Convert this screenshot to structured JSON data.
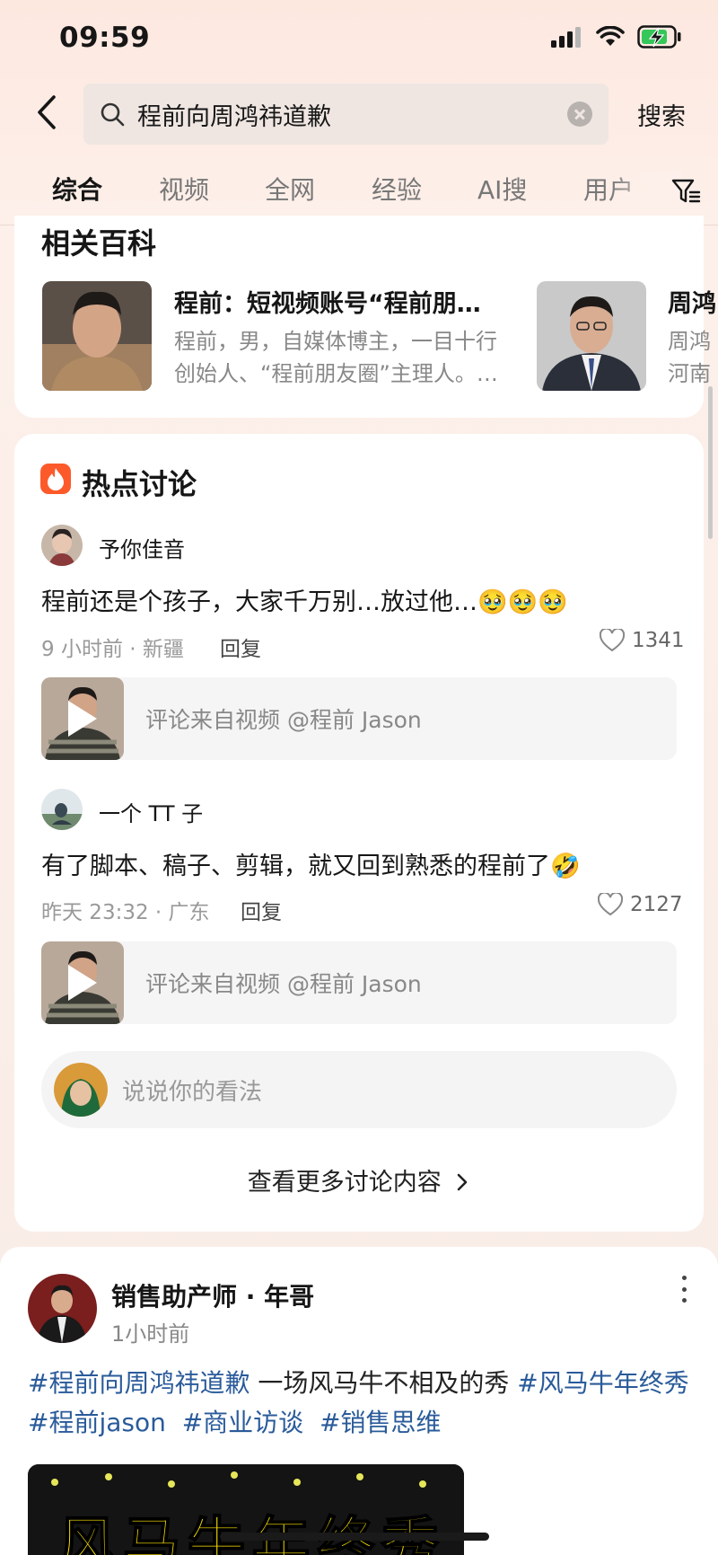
{
  "status_bar": {
    "time": "09:59"
  },
  "search": {
    "query": "程前向周鸿祎道歉",
    "button_label": "搜索"
  },
  "tabs": [
    {
      "label": "综合",
      "active": true
    },
    {
      "label": "视频"
    },
    {
      "label": "全网"
    },
    {
      "label": "经验"
    },
    {
      "label": "AI搜"
    },
    {
      "label": "用户"
    }
  ],
  "baike": {
    "title": "相关百科",
    "items": [
      {
        "title": "程前：短视频账号“程前朋…",
        "desc_line1": "程前，男，自媒体博主，一目十行",
        "desc_line2": "创始人、“程前朋友圈”主理人。…"
      },
      {
        "title": "周鸿",
        "desc_line1": "周鸿",
        "desc_line2": "河南"
      }
    ]
  },
  "hot": {
    "title": "热点讨论",
    "comments": [
      {
        "user": "予你佳音",
        "text": "程前还是个孩子，大家千万别…放过他…",
        "emoji": "🥹🥹🥹",
        "meta": "9 小时前 · 新疆",
        "reply": "回复",
        "likes": "1341",
        "video_source": "评论来自视频 @程前 Jason"
      },
      {
        "user": "一个 TT 子",
        "text": "有了脚本、稿子、剪辑，就又回到熟悉的程前了",
        "emoji": "🤣",
        "meta": "昨天 23:32 · 广东",
        "reply": "回复",
        "likes": "2127",
        "video_source": "评论来自视频 @程前 Jason"
      }
    ],
    "input_placeholder": "说说你的看法",
    "more": "查看更多讨论内容"
  },
  "post": {
    "author": "销售助产师 · 年哥",
    "time": "1小时前",
    "tag1": "#程前向周鸿祎道歉",
    "text": " 一场风马牛不相及的秀 ",
    "tag2": "#风马牛年终秀",
    "tag3": "#程前jason",
    "tag4": "#商业访谈",
    "tag5": "#销售思维",
    "video_title": "风马牛年终秀"
  },
  "colors": {
    "accent": "#fd5a2b",
    "tag": "#2a5b9a",
    "battery": "#35c759"
  }
}
